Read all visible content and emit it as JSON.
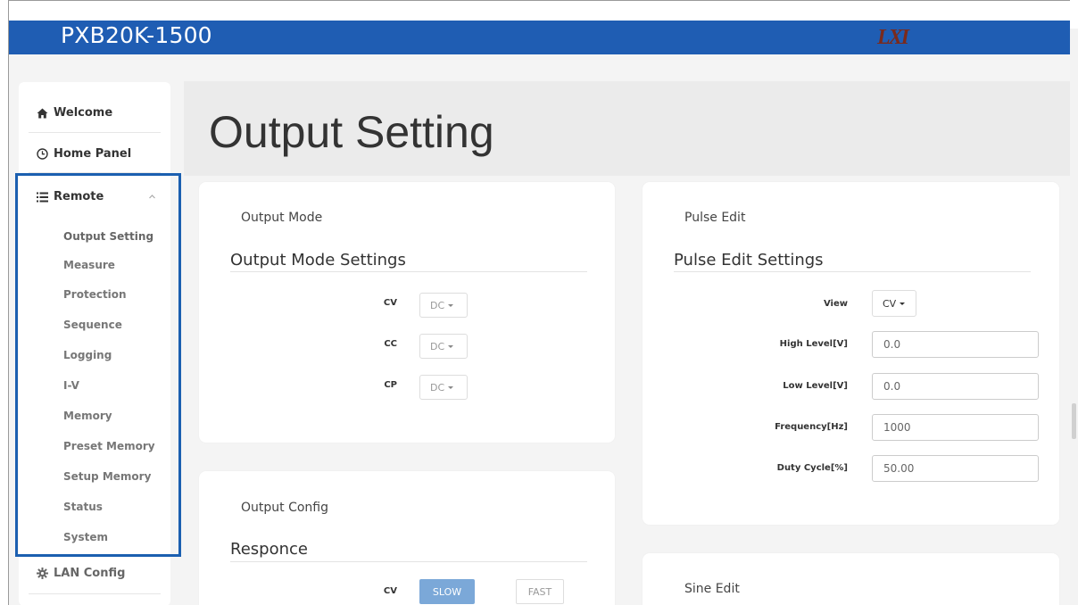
{
  "header": {
    "app_title": "PXB20K-1500",
    "logo_text": "LXI",
    "brand_color": "#1f5db3"
  },
  "sidebar": {
    "items": [
      {
        "label": "Welcome",
        "icon": "home-icon"
      },
      {
        "label": "Home Panel",
        "icon": "clock-icon"
      },
      {
        "label": "Remote",
        "icon": "list-icon"
      },
      {
        "label": "LAN Config",
        "icon": "gear-icon"
      }
    ],
    "remote_subitems": [
      "Output Setting",
      "Measure",
      "Protection",
      "Sequence",
      "Logging",
      "I-V",
      "Memory",
      "Preset Memory",
      "Setup Memory",
      "Status",
      "System"
    ],
    "active_subitem": "Output Setting"
  },
  "main": {
    "page_title": "Output Setting",
    "output_mode": {
      "card_label": "Output Mode",
      "section_title": "Output Mode Settings",
      "rows": [
        {
          "label": "CV",
          "value": "DC"
        },
        {
          "label": "CC",
          "value": "DC"
        },
        {
          "label": "CP",
          "value": "DC"
        }
      ]
    },
    "pulse_edit": {
      "card_label": "Pulse Edit",
      "section_title": "Pulse Edit Settings",
      "view_label": "View",
      "view_value": "CV",
      "fields": [
        {
          "label": "High Level[V]",
          "value": "0.0"
        },
        {
          "label": "Low Level[V]",
          "value": "0.0"
        },
        {
          "label": "Frequency[Hz]",
          "value": "1000"
        },
        {
          "label": "Duty Cycle[%]",
          "value": "50.00"
        }
      ]
    },
    "output_config": {
      "card_label": "Output Config",
      "section_title": "Responce",
      "row_label": "CV",
      "slow_label": "SLOW",
      "fast_label": "FAST"
    },
    "sine_edit": {
      "card_label": "Sine Edit"
    }
  }
}
